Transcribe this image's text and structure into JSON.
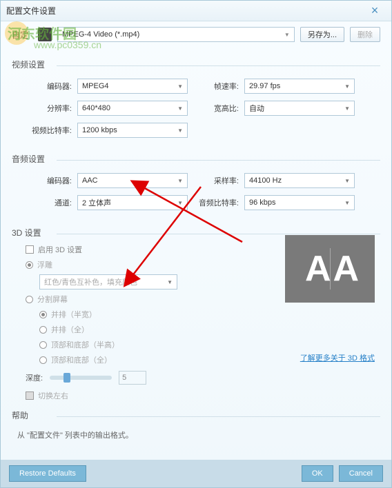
{
  "window": {
    "title": "配置文件设置"
  },
  "watermark": {
    "name": "河东软件园",
    "url": "www.pc0359.cn"
  },
  "top": {
    "label": "自定",
    "file": "MPEG-4 Video (*.mp4)",
    "saveAs": "另存为...",
    "delete": "删除"
  },
  "video": {
    "title": "视频设置",
    "encoder_label": "编码器:",
    "encoder": "MPEG4",
    "res_label": "分辨率:",
    "res": "640*480",
    "bitrate_label": "视频比特率:",
    "bitrate": "1200 kbps",
    "fps_label": "帧速率:",
    "fps": "29.97 fps",
    "aspect_label": "宽高比:",
    "aspect": "自动"
  },
  "audio": {
    "title": "音频设置",
    "encoder_label": "编码器:",
    "encoder": "AAC",
    "channel_label": "通道:",
    "channel": "2 立体声",
    "sample_label": "采样率:",
    "sample": "44100 Hz",
    "bitrate_label": "音频比特率:",
    "bitrate": "96 kbps"
  },
  "threed": {
    "title": "3D 设置",
    "enable": "启用 3D 设置",
    "anaglyph": "浮雕",
    "anaglyph_mode": "红色/青色互补色，填充颜色",
    "split": "分割屏幕",
    "opt1": "并排（半宽）",
    "opt2": "并排（全）",
    "opt3": "顶部和底部（半高）",
    "opt4": "顶部和底部（全）",
    "depth_label": "深度:",
    "depth_value": "5",
    "swap": "切换左右",
    "link": "了解更多关于 3D 格式"
  },
  "help": {
    "title": "帮助",
    "text": "从 \"配置文件\" 列表中的输出格式。"
  },
  "footer": {
    "restore": "Restore Defaults",
    "ok": "OK",
    "cancel": "Cancel"
  }
}
